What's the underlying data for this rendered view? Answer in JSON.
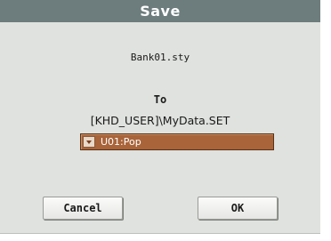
{
  "dialog": {
    "title": "Save",
    "filename": "Bank01.sty",
    "to_label": "To",
    "path": "[KHD_USER]\\MyData.SET",
    "bank_select": {
      "value": "U01:Pop"
    },
    "buttons": {
      "cancel": "Cancel",
      "ok": "OK"
    }
  },
  "colors": {
    "title_bar": "#6d7c7c",
    "dialog_bg": "#dfe2de",
    "select_bg": "#a9643a"
  }
}
